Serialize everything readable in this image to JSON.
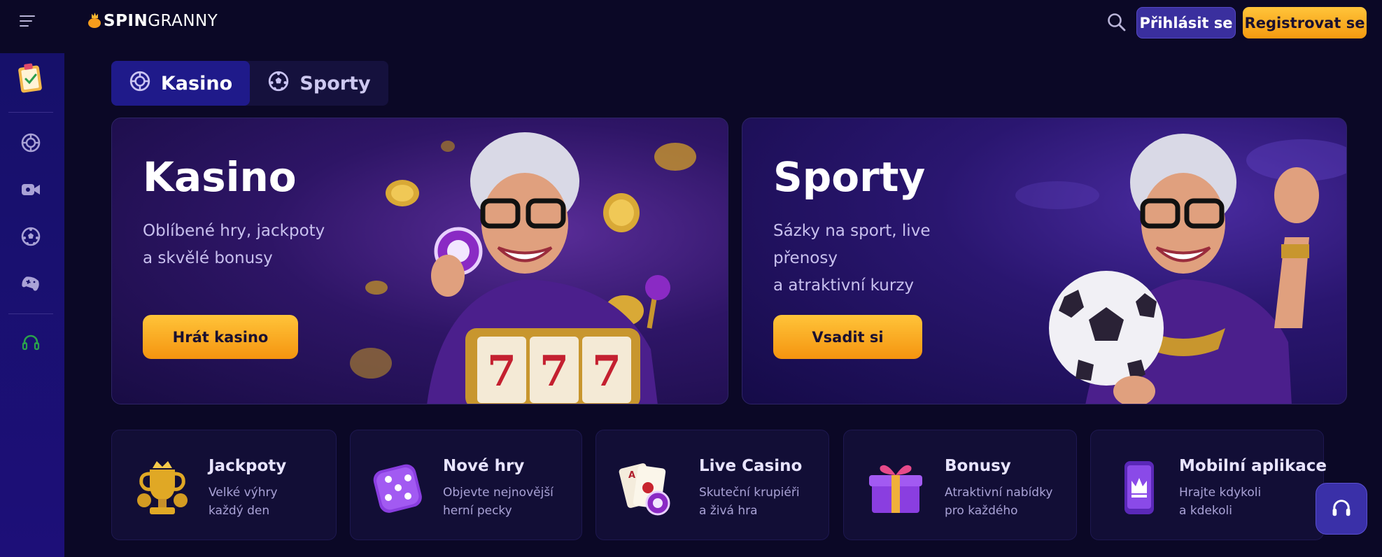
{
  "header": {
    "logo_spin": "SPIN",
    "logo_granny": "GRANNY",
    "login_label": "Přihlásit se",
    "register_label": "Registrovat se"
  },
  "sidebar": {
    "items": [
      {
        "icon": "clipboard-icon"
      },
      {
        "icon": "casino-chip-icon"
      },
      {
        "icon": "live-camera-icon"
      },
      {
        "icon": "soccer-ball-icon"
      },
      {
        "icon": "gamepad-icon"
      },
      {
        "icon": "headset-icon"
      }
    ]
  },
  "tabs": [
    {
      "label": "Kasino",
      "active": true,
      "icon": "casino-chip-icon"
    },
    {
      "label": "Sporty",
      "active": false,
      "icon": "soccer-ball-icon"
    }
  ],
  "hero": {
    "casino": {
      "title": "Kasino",
      "sub_line1": "Oblíbené hry, jackpoty",
      "sub_line2": "a skvělé bonusy",
      "button": "Hrát kasino"
    },
    "sports": {
      "title": "Sporty",
      "sub_line1": "Sázky na sport, live přenosy",
      "sub_line2": "a atraktivní kurzy",
      "button": "Vsadit si"
    }
  },
  "categories": [
    {
      "title": "Jackpoty",
      "desc1": "Velké výhry",
      "desc2": "každý den",
      "icon": "trophy-icon"
    },
    {
      "title": "Nové hry",
      "desc1": "Objevte nejnovější",
      "desc2": "herní pecky",
      "icon": "dice-icon"
    },
    {
      "title": "Live Casino",
      "desc1": "Skuteční krupiéři",
      "desc2": "a živá hra",
      "icon": "playing-cards-icon"
    },
    {
      "title": "Bonusy",
      "desc1": "Atraktivní nabídky",
      "desc2": "pro každého",
      "icon": "gift-icon"
    },
    {
      "title": "Mobilní aplikace",
      "desc1": "Hrajte kdykoli",
      "desc2": "a kdekoli",
      "icon": "smartphone-icon"
    }
  ],
  "colors": {
    "background": "#0b0826",
    "sidebar": "#16106a",
    "accent_orange": "#f7a81b",
    "accent_purple": "#3a2f9e"
  }
}
